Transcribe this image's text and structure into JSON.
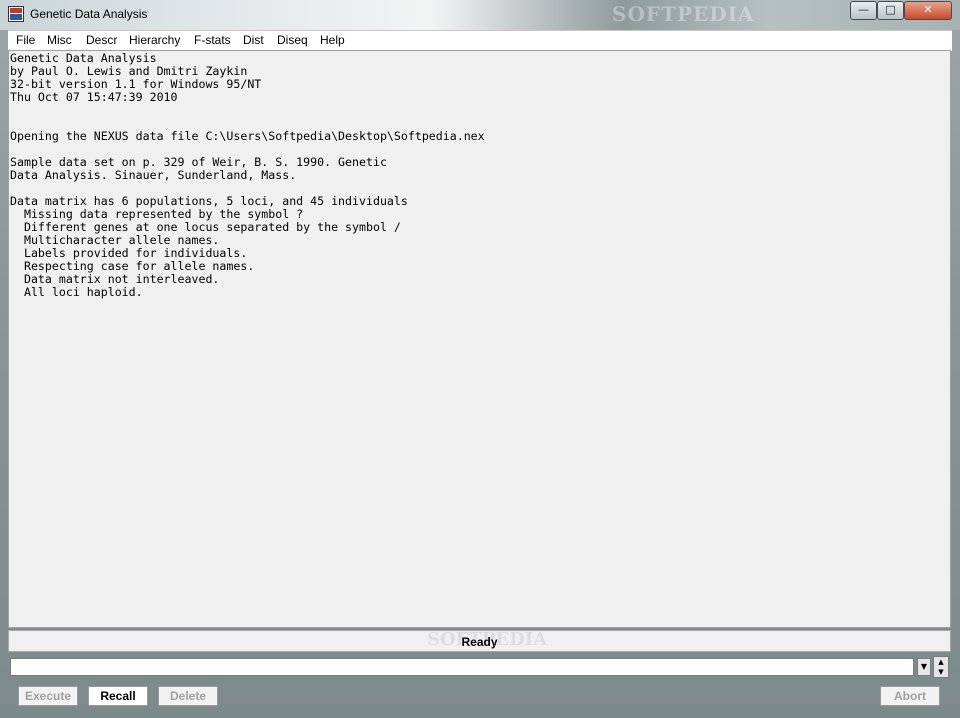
{
  "window": {
    "title": "Genetic Data Analysis",
    "watermark": "SOFTPEDIA"
  },
  "controls": {
    "minimize": "—",
    "maximize": "□",
    "close": "✕"
  },
  "menu": [
    "File",
    "Misc",
    "Descr",
    "Hierarchy",
    "F-stats",
    "Dist",
    "Diseq",
    "Help"
  ],
  "output_lines": [
    "Genetic Data Analysis",
    "by Paul O. Lewis and Dmitri Zaykin",
    "32-bit version 1.1 for Windows 95/NT",
    "Thu Oct 07 15:47:39 2010",
    "",
    "",
    "Opening the NEXUS data file C:\\Users\\Softpedia\\Desktop\\Softpedia.nex",
    "",
    "Sample data set on p. 329 of Weir, B. S. 1990. Genetic",
    "Data Analysis. Sinauer, Sunderland, Mass.",
    "",
    "Data matrix has 6 populations, 5 loci, and 45 individuals",
    "  Missing data represented by the symbol ?",
    "  Different genes at one locus separated by the symbol /",
    "  Multicharacter allele names.",
    "  Labels provided for individuals.",
    "  Respecting case for allele names.",
    "  Data matrix not interleaved.",
    "  All loci haploid."
  ],
  "status": {
    "text": "Ready",
    "watermark": "SOFTPEDIA"
  },
  "command": {
    "value": ""
  },
  "buttons": {
    "execute": "Execute",
    "recall": "Recall",
    "delete": "Delete",
    "abort": "Abort"
  }
}
